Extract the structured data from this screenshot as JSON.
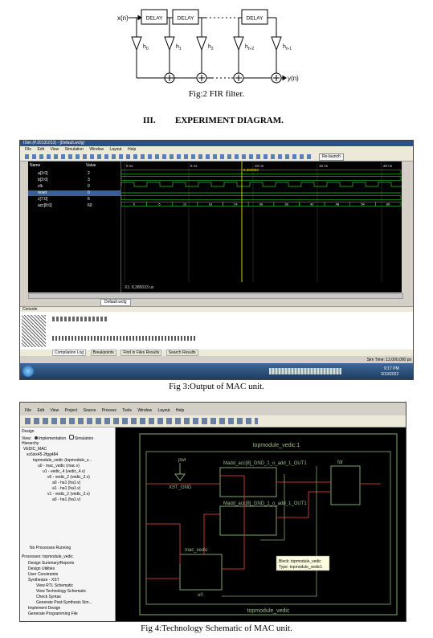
{
  "fig2": {
    "input_label": "x(n)",
    "delay_label": "DELAY",
    "taps": [
      "h",
      "h",
      "h",
      "h",
      "h"
    ],
    "tap_subs": [
      "0",
      "1",
      "2",
      "n-2",
      "n-1"
    ],
    "output_label": "y(n)",
    "caption": "Fig:2 FIR filter."
  },
  "section": {
    "number": "III.",
    "title": "EXPERIMENT DIAGRAM."
  },
  "fig3": {
    "caption": "Fig 3:Output of MAC unit.",
    "window_title": "ISim (P.20131013) - [Default.wcfg]",
    "menu": [
      "File",
      "Edit",
      "View",
      "Simulation",
      "Window",
      "Layout",
      "Help"
    ],
    "relaunch_label": "Re-launch",
    "col_name": "Name",
    "col_value": "Value",
    "signals": [
      {
        "name": "a[3:0]",
        "value": "2"
      },
      {
        "name": "b[3:0]",
        "value": "3"
      },
      {
        "name": "clk",
        "value": "0"
      },
      {
        "name": "reset",
        "value": "0"
      },
      {
        "name": "c[7:0]",
        "value": "6"
      },
      {
        "name": "acc[8:0]",
        "value": "60"
      }
    ],
    "time_ticks": [
      "0 ns",
      "5 ns",
      "10 ns",
      "15 ns",
      "20 ns"
    ],
    "acc_values": [
      "0",
      "6",
      "12",
      "18",
      "24",
      "30",
      "36",
      "42",
      "48",
      "54",
      "60"
    ],
    "cursor_time": "8,380033",
    "cursor_readout": "X1: 8,380033 us",
    "tab_label": "Default.wcfg",
    "console_label": "Console",
    "bottom_tabs": [
      "Compilation Log",
      "Breakpoints",
      "Find in Files Results",
      "Search Results"
    ],
    "sim_time": "Sim Time: 12,000,000 ps",
    "clock_time": "9:17 PM",
    "clock_date": "3/19/2022"
  },
  "fig4": {
    "caption": "Fig 4:Technology Schematic of MAC unit.",
    "menu": [
      "File",
      "Edit",
      "View",
      "Project",
      "Source",
      "Process",
      "Tools",
      "Window",
      "Layout",
      "Help"
    ],
    "design_label": "Design",
    "view_label": "View:",
    "implementation_label": "Implementation",
    "simulation_label": "Simulation",
    "hierarchy_label": "Hierarchy",
    "tree": [
      "VEDIC_MAC",
      "xc6slx45-2fgg484",
      "topmodule_vedic (topmodule_v...",
      "u0 - mac_vedic (mac.v)",
      "u1 - vedic_4 (vedic_4.v)",
      "v0 - vedic_2 (vedic_2.v)",
      "a0 - ha1 (ha1.v)",
      "a1 - ha1 (ha1.v)",
      "v1 - vedic_2 (vedic_2.v)",
      "a0 - ha1 (ha1.v)"
    ],
    "no_process": "No Processes Running",
    "processes_label": "Processes: topmodule_vedic",
    "processes": [
      "Design Summary/Reports",
      "Design Utilities",
      "User Constraints",
      "Synthesize - XST",
      "View RTL Schematic",
      "View Technology Schematic",
      "Check Syntax",
      "Generate Post-Synthesis Sim...",
      "Implement Design",
      "Generate Programming File"
    ],
    "top_title": "topmodule_vedic:1",
    "bottom_title": "topmodule_vedic",
    "gnd_label": "XST_GND",
    "pwr_label": "pwr",
    "madd_top": "Madd_acc[8]_GND_1_o_add_1_OUT1",
    "madd_bot": "Madd_acc[8]_GND_1_o_add_1_OUT1",
    "fdr_label": "fdr",
    "mac_label": "mac_vedic",
    "u0_label": "u0",
    "tooltip_block": "Block: topmodule_vedic",
    "tooltip_type": "Type: topmodule_vedic1"
  }
}
